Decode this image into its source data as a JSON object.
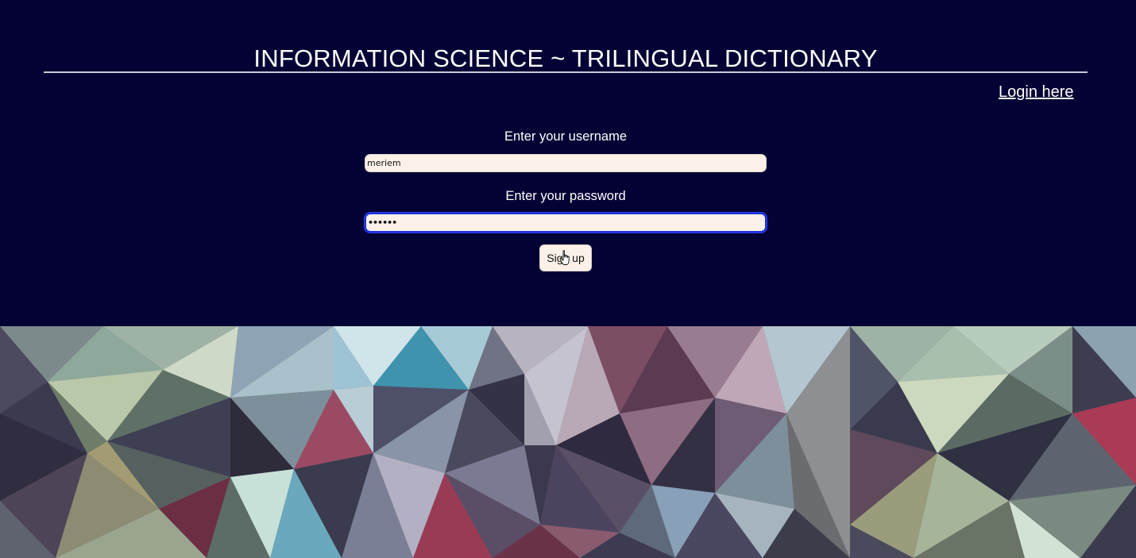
{
  "header": {
    "title": "INFORMATION SCIENCE ~ TRILINGUAL DICTIONARY",
    "login_link": "Login here"
  },
  "form": {
    "username": {
      "label": "Enter your username",
      "value": "meriem"
    },
    "password": {
      "label": "Enter your password",
      "value": "••••••"
    },
    "signup_label": "Sign up"
  },
  "colors": {
    "background": "#040134",
    "input_fill": "#fbf1e8",
    "focus_ring": "#1c2fd8"
  },
  "icons": {
    "cursor": "hand-pointer-icon"
  }
}
